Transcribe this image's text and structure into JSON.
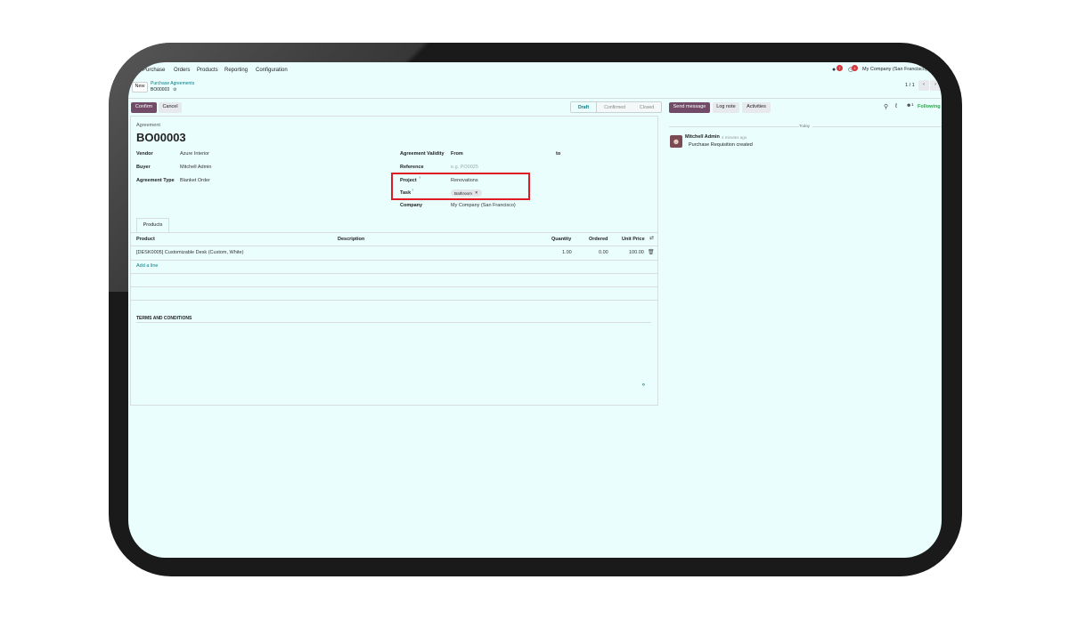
{
  "nav": {
    "app": "Purchase",
    "menu": [
      "Orders",
      "Products",
      "Reporting",
      "Configuration"
    ],
    "company": "My Company (San Francisco)",
    "chat_badge": "7",
    "activity_badge": "4"
  },
  "control": {
    "new_label": "New",
    "breadcrumb_parent": "Purchase Agreements",
    "record_name": "BO00003",
    "pager": "1 / 1"
  },
  "actions": {
    "confirm": "Confirm",
    "cancel": "Cancel",
    "statuses": [
      "Draft",
      "Confirmed",
      "Closed"
    ]
  },
  "chatter_actions": {
    "send_message": "Send message",
    "log_note": "Log note",
    "activities": "Activities",
    "followers_count": "1",
    "following": "Following"
  },
  "form": {
    "record_type": "Agreement",
    "title": "BO00003",
    "vendor_label": "Vendor",
    "vendor_value": "Azure Interior",
    "buyer_label": "Buyer",
    "buyer_value": "Mitchell Admin",
    "agreement_type_label": "Agreement Type",
    "agreement_type_value": "Blanket Order",
    "validity_label": "Agreement Validity",
    "validity_from": "From",
    "validity_to": "to",
    "reference_label": "Reference",
    "reference_placeholder": "e.g. PO0025",
    "project_label": "Project",
    "project_value": "Renovations",
    "task_label": "Task",
    "task_tag": "Bathroom",
    "company_label": "Company",
    "company_value": "My Company (San Francisco)",
    "help_mark": "?"
  },
  "products": {
    "tab": "Products",
    "columns": [
      "Product",
      "Description",
      "Quantity",
      "Ordered",
      "Unit Price"
    ],
    "rows": [
      {
        "product": "[DESK0005] Customizable Desk (Custom, White)",
        "description": "",
        "quantity": "1.00",
        "ordered": "0.00",
        "unit_price": "100.00"
      }
    ],
    "add_line": "Add a line"
  },
  "terms": {
    "title": "TERMS AND CONDITIONS"
  },
  "chatter": {
    "date_sep": "Today",
    "author": "Mitchell Admin",
    "time": "4 minutes ago",
    "message": "Purchase Requisition created"
  },
  "colors": {
    "primary": "#714b67",
    "teal": "#017e84",
    "background": "#eafefe",
    "highlight": "#e01b24"
  }
}
